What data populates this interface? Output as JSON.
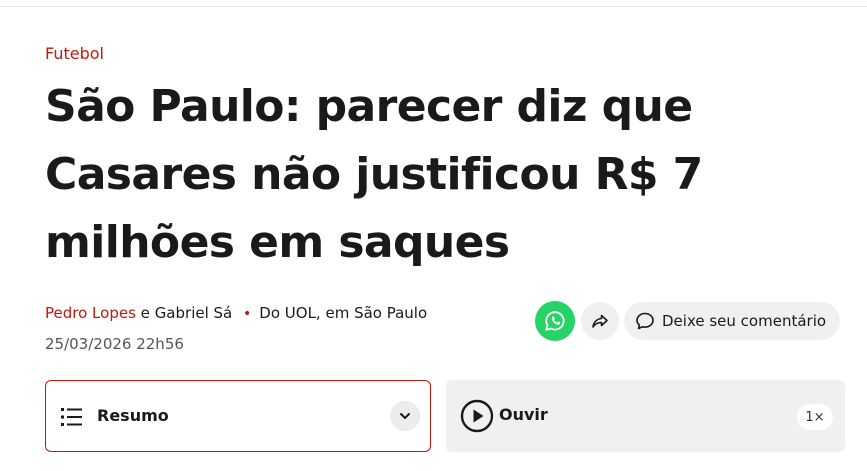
{
  "article": {
    "category": "Futebol",
    "headline": "São Paulo: parecer diz que Casares não justificou R$ 7 milhões em saques",
    "byline": {
      "author_primary": "Pedro Lopes",
      "conjunction": "e",
      "author_secondary": "Gabriel Sá",
      "separator": "•",
      "source": "Do UOL, em São Paulo"
    },
    "timestamp": "25/03/2026 22h56"
  },
  "actions": {
    "whatsapp_icon": "whatsapp-icon",
    "share_icon": "share-arrow-icon",
    "comment_icon": "speech-bubble-icon",
    "comment_label": "Deixe seu comentário"
  },
  "summary": {
    "icon": "list-icon",
    "label": "Resumo",
    "expand_icon": "chevron-down-icon"
  },
  "audio": {
    "play_icon": "play-circle-icon",
    "label": "Ouvir",
    "speed": "1×"
  },
  "colors": {
    "accent": "#c4170c",
    "whatsapp": "#25d366",
    "text": "#1a1a1a",
    "muted": "#555555",
    "chip_bg": "#f0f0f0"
  }
}
